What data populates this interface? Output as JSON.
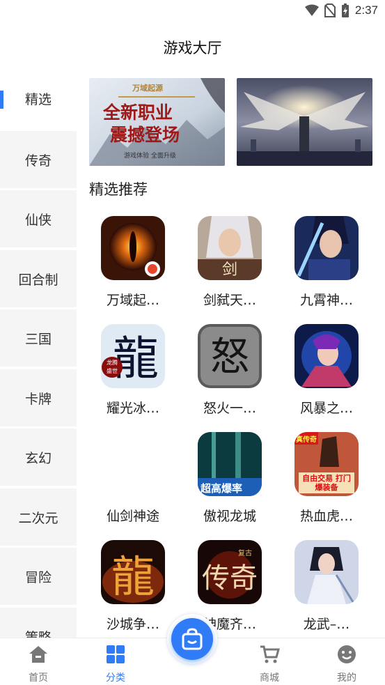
{
  "status_bar": {
    "time": "2:37",
    "icons": [
      "wifi-icon",
      "no-sim-icon",
      "battery-icon"
    ]
  },
  "header": {
    "title": "游戏大厅"
  },
  "sidebar": {
    "items": [
      {
        "label": "精选",
        "active": true
      },
      {
        "label": "传奇"
      },
      {
        "label": "仙侠"
      },
      {
        "label": "回合制"
      },
      {
        "label": "三国"
      },
      {
        "label": "卡牌"
      },
      {
        "label": "玄幻"
      },
      {
        "label": "二次元"
      },
      {
        "label": "冒险"
      },
      {
        "label": "策略"
      }
    ]
  },
  "banners": [
    {
      "line1": "万域起源",
      "line2": "全新职业",
      "line3": "震撼登场",
      "line4": "游戏体验 全面升级"
    },
    {
      "caption": ""
    }
  ],
  "section": {
    "title": "精选推荐"
  },
  "games": [
    {
      "name": "万域起…",
      "icon": "dragon-eye-icon"
    },
    {
      "name": "剑弑天…",
      "icon": "white-hair-hero-icon"
    },
    {
      "name": "九霄神…",
      "icon": "swordsman-icon"
    },
    {
      "name": "耀光冰…",
      "icon": "dragon-character-icon",
      "glyph": "龍",
      "sub": "龙腾盛世"
    },
    {
      "name": "怒火一…",
      "icon": "fury-character-icon",
      "glyph": "怒"
    },
    {
      "name": "风暴之…",
      "icon": "anime-warrior-icon"
    },
    {
      "name": "仙剑神途",
      "icon": ""
    },
    {
      "name": "傲视龙城",
      "icon": "high-drop-rate-icon",
      "badge": "超高爆率"
    },
    {
      "name": "热血虎…",
      "icon": "legend-trade-icon",
      "badge": "自由交易 打门爆装备",
      "tag": "真传奇"
    },
    {
      "name": "沙城争…",
      "icon": "fire-dragon-icon",
      "glyph": "龍"
    },
    {
      "name": "神魔齐…",
      "icon": "legend-retro-icon",
      "glyph": "传奇",
      "tag": "复古"
    },
    {
      "name": "龙武–…",
      "icon": "swordswoman-icon"
    }
  ],
  "tabbar": {
    "tabs": [
      {
        "label": "首页",
        "icon": "home-icon"
      },
      {
        "label": "分类",
        "icon": "category-grid-icon",
        "active": true
      },
      {
        "label": "商城",
        "icon": "cart-icon"
      },
      {
        "label": "我的",
        "icon": "profile-face-icon"
      }
    ],
    "center": {
      "icon": "shopping-bag-icon"
    }
  },
  "colors": {
    "accent": "#2f7cf6",
    "sidebar_bg": "#f5f5f5"
  }
}
